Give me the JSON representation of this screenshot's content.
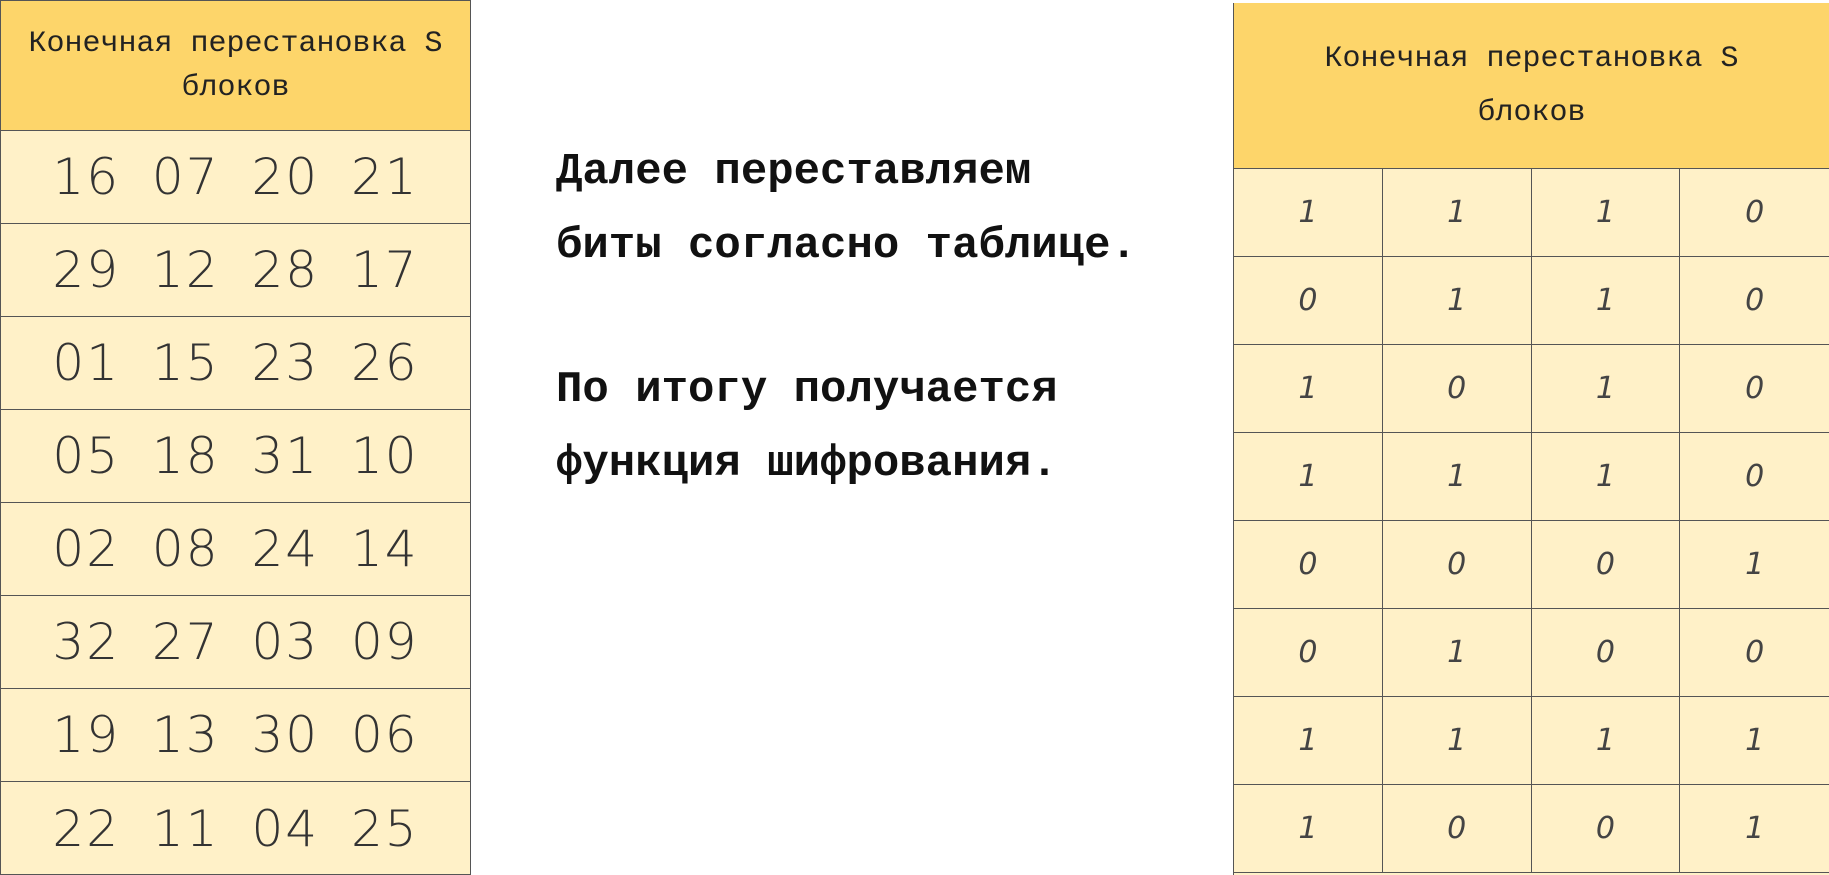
{
  "left_table": {
    "header": "Конечная перестановка S блоков",
    "rows": [
      "16 07 20 21",
      "29 12 28 17",
      "01 15 23 26",
      "05 18 31 10",
      "02 08 24 14",
      "32 27 03 09",
      "19 13 30 06",
      "22 11 04 25"
    ]
  },
  "middle_text": {
    "paragraph1_line1": "Далее переставляем",
    "paragraph1_line2": "биты согласно таблице.",
    "paragraph2_line1": "По итогу получается",
    "paragraph2_line2": "функция шифрования."
  },
  "right_table": {
    "header": "Конечная перестановка S блоков",
    "rows": [
      [
        "1",
        "1",
        "1",
        "0"
      ],
      [
        "0",
        "1",
        "1",
        "0"
      ],
      [
        "1",
        "0",
        "1",
        "0"
      ],
      [
        "1",
        "1",
        "1",
        "0"
      ],
      [
        "0",
        "0",
        "0",
        "1"
      ],
      [
        "0",
        "1",
        "0",
        "0"
      ],
      [
        "1",
        "1",
        "1",
        "1"
      ],
      [
        "1",
        "0",
        "0",
        "1"
      ]
    ]
  },
  "colors": {
    "header_bg": "#fdd56a",
    "cell_bg": "#fff1c8",
    "border": "#555555"
  }
}
